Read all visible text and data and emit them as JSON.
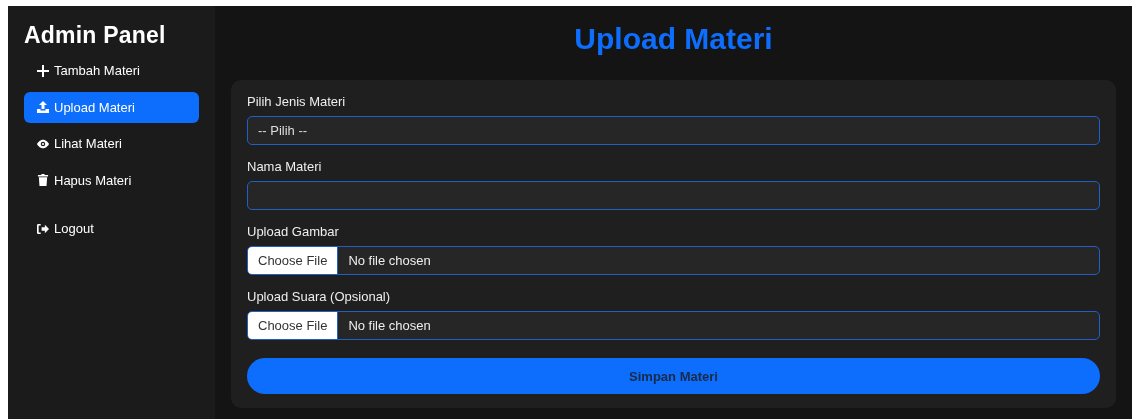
{
  "sidebar": {
    "title": "Admin Panel",
    "items": [
      {
        "label": "Tambah Materi",
        "selected": false
      },
      {
        "label": "Upload Materi",
        "selected": true
      },
      {
        "label": "Lihat Materi",
        "selected": false
      },
      {
        "label": "Hapus Materi",
        "selected": false
      }
    ],
    "logout": {
      "label": "Logout"
    }
  },
  "main": {
    "title": "Upload Materi",
    "fields": [
      {
        "kind": "select",
        "label": "Pilih Jenis Materi",
        "value": "-- Pilih --"
      },
      {
        "kind": "text",
        "label": "Nama Materi"
      },
      {
        "kind": "file",
        "label": "Upload Gambar",
        "button": "Choose File",
        "value": "No file chosen"
      },
      {
        "kind": "file",
        "label": "Upload Suara (Opsional)",
        "button": "Choose File",
        "value": "No file chosen"
      }
    ],
    "submit": "Simpan Materi"
  }
}
